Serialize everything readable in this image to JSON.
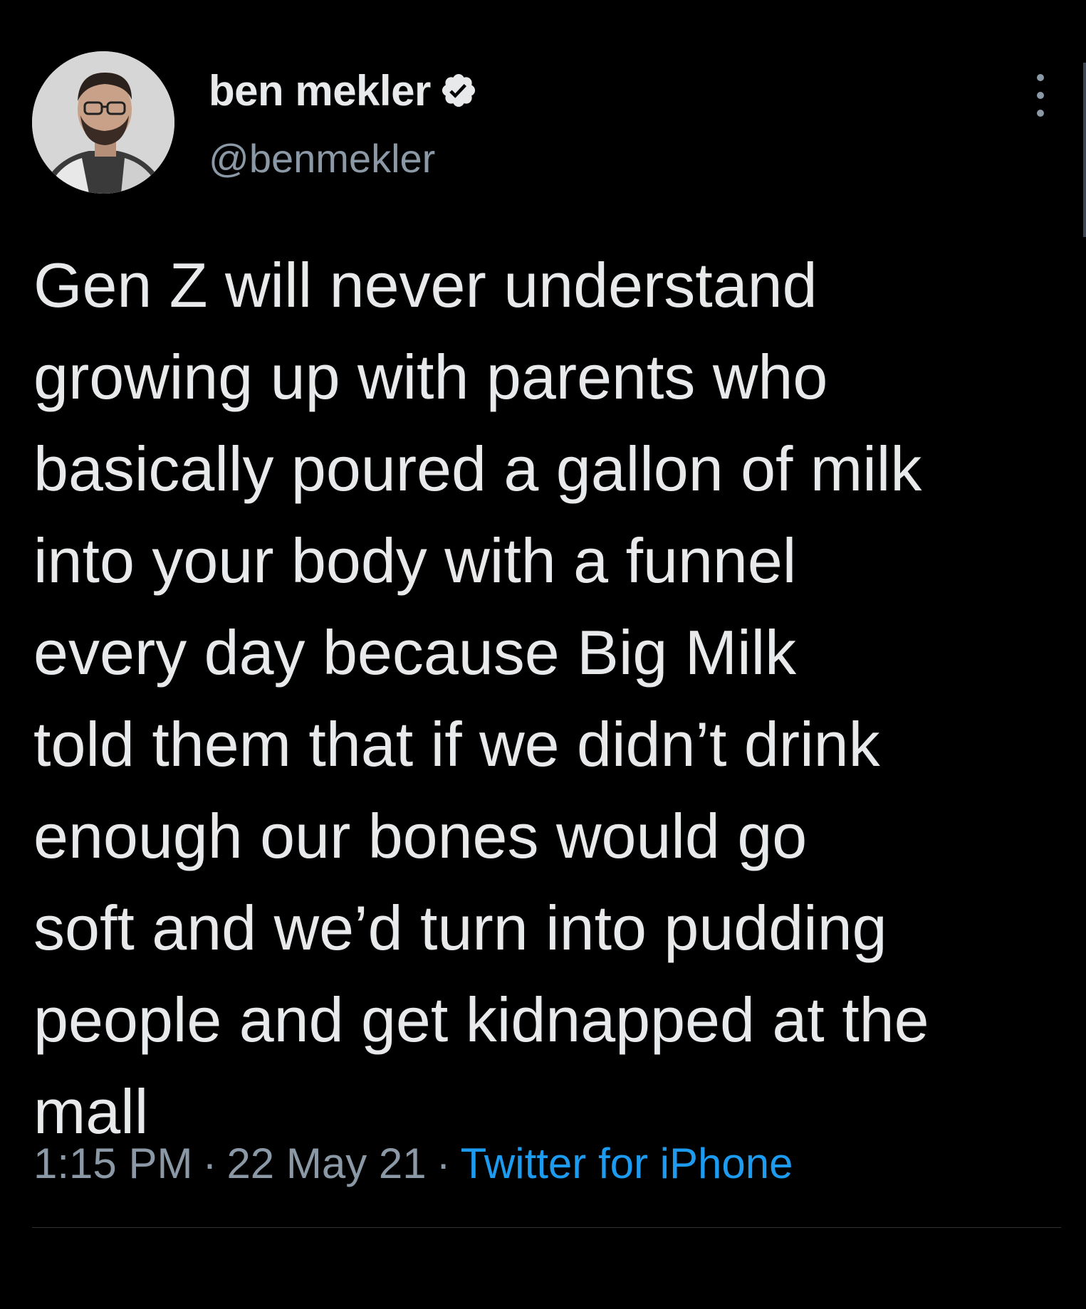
{
  "author": {
    "display_name": "ben mekler",
    "handle": "@benmekler",
    "verified": true
  },
  "tweet": {
    "text_lines": [
      "Gen Z will never understand",
      "growing up with parents who",
      "basically poured a gallon of milk",
      "into your body with a funnel",
      "every day because Big Milk",
      "told them that if we didn’t drink",
      "enough our bones would go",
      "soft and we’d turn into pudding",
      "people and get kidnapped at the",
      "mall"
    ],
    "time": "1:15 PM",
    "date": "22 May 21",
    "source": "Twitter for iPhone",
    "separator": "·"
  },
  "icons": {
    "verified": "verified-badge-icon",
    "more": "more-options-icon"
  },
  "colors": {
    "background": "#000000",
    "text": "#e7e9ea",
    "muted": "#8b98a5",
    "link": "#1d9bf0"
  }
}
